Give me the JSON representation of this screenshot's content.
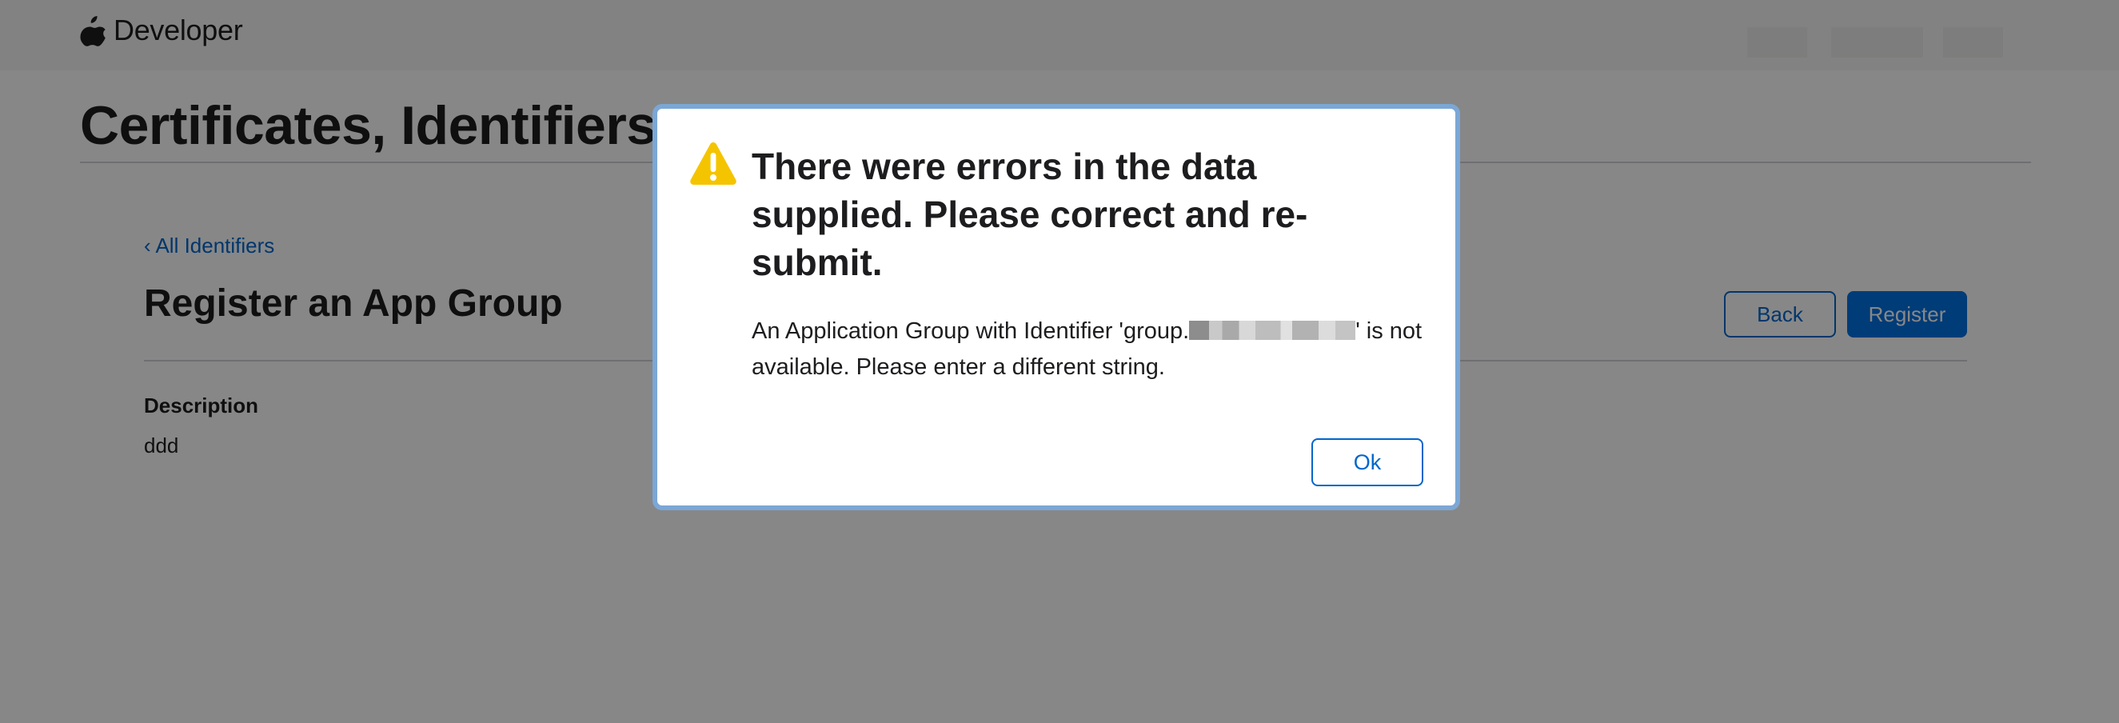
{
  "nav": {
    "brand_label": "Developer",
    "logo_icon": "apple-logo-icon"
  },
  "page": {
    "title": "Certificates, Identifiers"
  },
  "content": {
    "back_link": "‹ All Identifiers",
    "section_title": "Register an App Group",
    "back_button": "Back",
    "register_button": "Register",
    "description_label": "Description",
    "description_value": "ddd"
  },
  "modal": {
    "icon": "warning-icon",
    "title": "There were errors in the data supplied. Please correct and re-submit.",
    "message_before": "An Application Group with Identifier 'group.",
    "message_after": "' is not available. Please enter a different string.",
    "ok_button": "Ok"
  },
  "colors": {
    "accent": "#0066cc",
    "primary_button": "#0071e3",
    "warning": "#f5c400",
    "overlay": "rgba(0,0,0,0.47)"
  }
}
